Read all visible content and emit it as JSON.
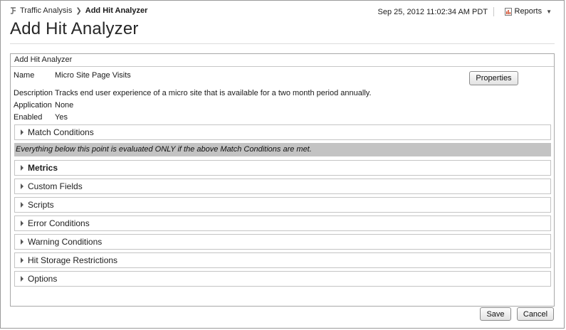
{
  "breadcrumb": {
    "parent": "Traffic Analysis",
    "current": "Add Hit Analyzer"
  },
  "header": {
    "datetime": "Sep 25, 2012 11:02:34 AM PDT",
    "reports_label": "Reports"
  },
  "page_title": "Add Hit Analyzer",
  "panel": {
    "title": "Add Hit Analyzer",
    "fields": {
      "name_label": "Name",
      "name_value": "Micro Site Page Visits",
      "description_label": "Description",
      "description_value": "Tracks end user experience of a micro site that is available for a two month period annually.",
      "application_label": "Application",
      "application_value": "None",
      "enabled_label": "Enabled",
      "enabled_value": "Yes"
    },
    "properties_button": "Properties",
    "match_conditions": "Match Conditions",
    "notice": "Everything below this point is evaluated ONLY if the above Match Conditions are met.",
    "sections": [
      "Metrics",
      "Custom Fields",
      "Scripts",
      "Error Conditions",
      "Warning Conditions",
      "Hit Storage Restrictions",
      "Options"
    ]
  },
  "footer": {
    "save": "Save",
    "cancel": "Cancel"
  },
  "colors": {
    "notice_bg": "#c3c3c3",
    "border": "#c4c4c4"
  }
}
